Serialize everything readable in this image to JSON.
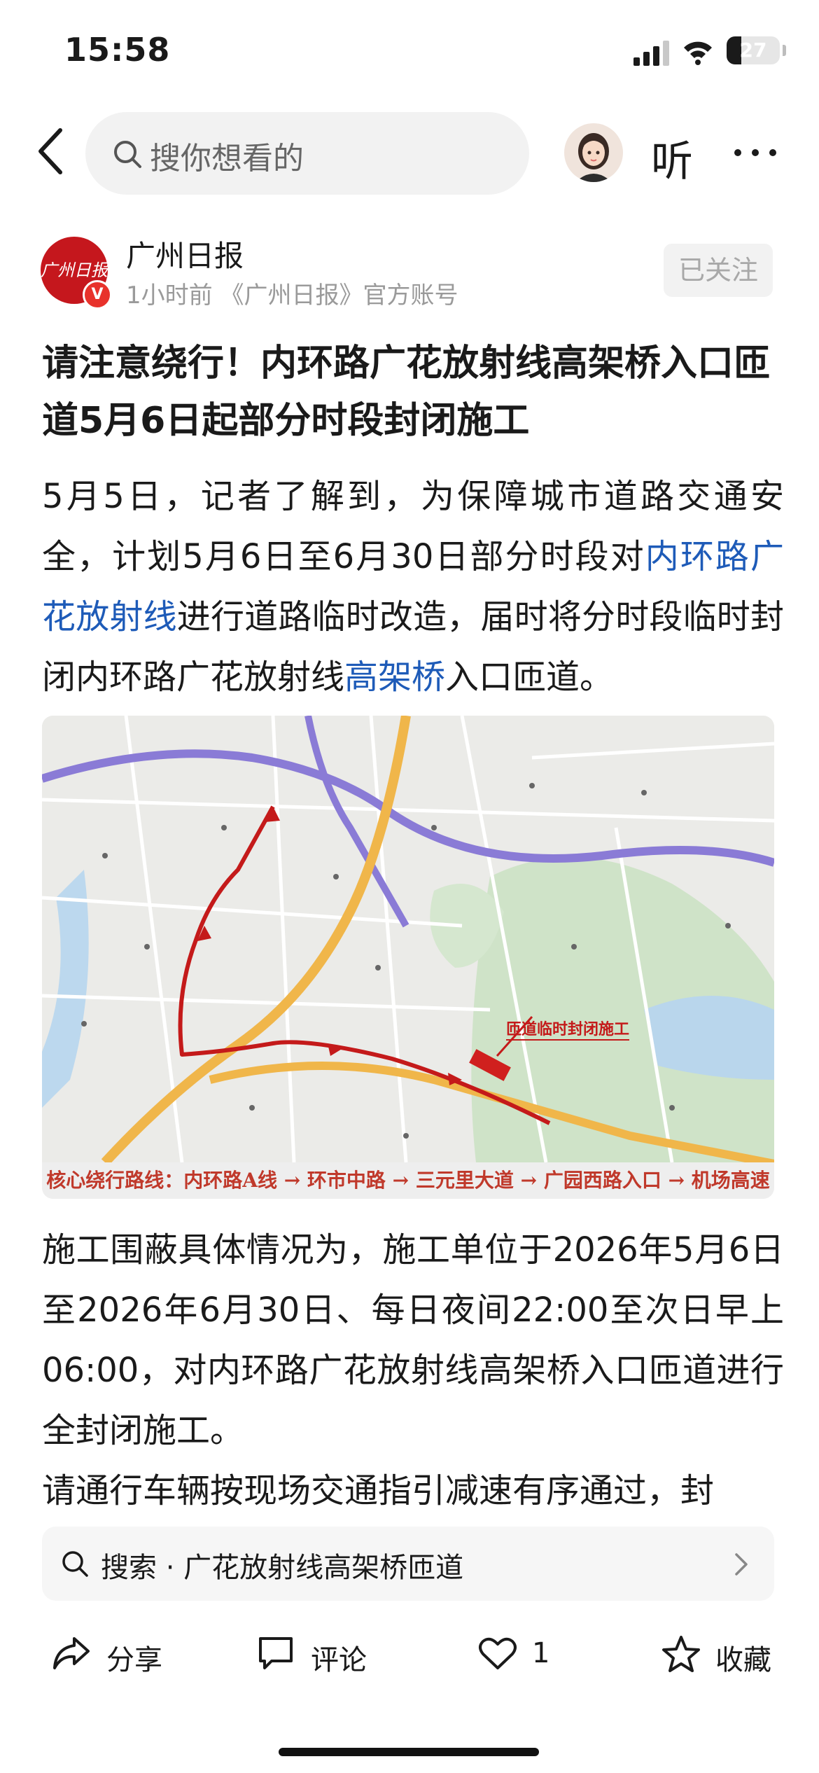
{
  "status_bar": {
    "time": "15:58",
    "battery_level": "27",
    "battery_fraction": 0.27
  },
  "header": {
    "search_placeholder": "搜你想看的",
    "listen_label": "听"
  },
  "author": {
    "name": "广州日报",
    "meta": "1小时前 《广州日报》官方账号",
    "logo_text": "广州日报",
    "verified_mark": "V",
    "follow_label": "已关注"
  },
  "article": {
    "title": "请注意绕行！内环路广花放射线高架桥入口匝道5月6日起部分时段封闭施工",
    "para1": {
      "part1": "5月5日，记者了解到，为保障城市道路交通安全，计划5月6日至6月30日部分时段对",
      "link1": "内环路广花放射线",
      "part2": "进行道路临时改造，届时将分时段临时封闭内环路广花放射线",
      "link2": "高架桥",
      "part3": "入口匝道。"
    },
    "para2": "施工围蔽具体情况为，施工单位于2026年5月6日至2026年6月30日、每日夜间22:00至次日早上06:00，对内环路广花放射线高架桥入口匝道进行全封闭施工。",
    "para3": "请通行车辆按现场交通指引减速有序通过，封"
  },
  "map": {
    "annotation": "匝道临时封闭施工",
    "caption": "核心绕行路线：内环路A线 → 环市中路 → 三元里大道 → 广园西路入口 → 机场高速"
  },
  "search_suggestion": {
    "text": "搜索 · 广花放射线高架桥匝道"
  },
  "actions": {
    "share": "分享",
    "comment": "评论",
    "like_count": "1",
    "favorite": "收藏"
  },
  "colors": {
    "link": "#1e5bb8",
    "route": "#c41a1a",
    "accent_red": "#e8322b"
  },
  "icons": [
    "back-icon",
    "search-icon",
    "more-icon",
    "share-icon",
    "comment-icon",
    "heart-icon",
    "star-icon",
    "chevron-right-icon"
  ]
}
